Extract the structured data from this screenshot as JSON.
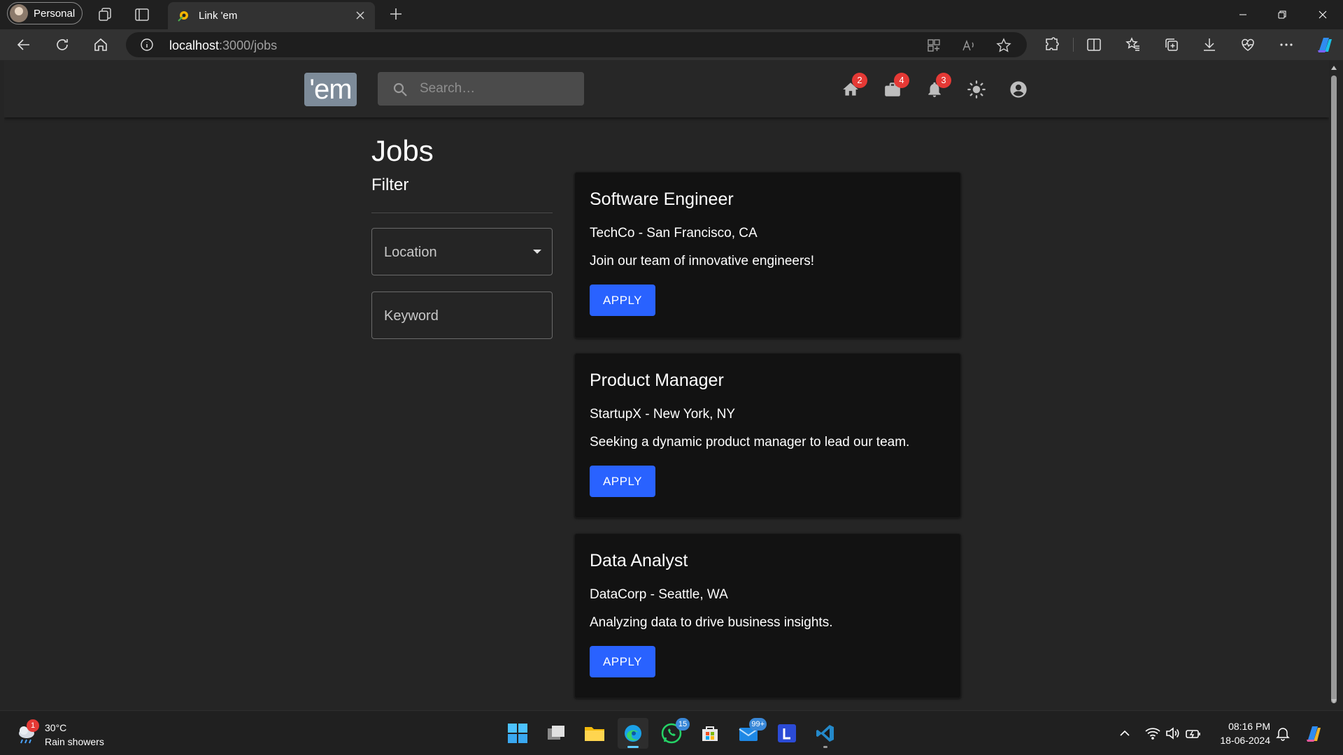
{
  "browser": {
    "profile_label": "Personal",
    "tab_title": "Link 'em",
    "url_host": "localhost",
    "url_path": ":3000/jobs"
  },
  "app": {
    "logo_text": "'em",
    "search_placeholder": "Search…",
    "icons": [
      "home-icon",
      "briefcase-icon",
      "bell-icon",
      "brightness-icon",
      "account-circle-icon"
    ],
    "badges": {
      "home": "2",
      "jobs": "4",
      "notifications": "3"
    }
  },
  "page": {
    "title": "Jobs",
    "filter_heading": "Filter",
    "location_label": "Location",
    "keyword_label": "Keyword"
  },
  "jobs": [
    {
      "title": "Software Engineer",
      "company": "TechCo - San Francisco, CA",
      "description": "Join our team of innovative engineers!",
      "apply_label": "APPLY"
    },
    {
      "title": "Product Manager",
      "company": "StartupX - New York, NY",
      "description": "Seeking a dynamic product manager to lead our team.",
      "apply_label": "APPLY"
    },
    {
      "title": "Data Analyst",
      "company": "DataCorp - Seattle, WA",
      "description": "Analyzing data to drive business insights.",
      "apply_label": "APPLY"
    }
  ],
  "taskbar": {
    "weather_temp": "30°C",
    "weather_condition": "Rain showers",
    "weather_badge": "1",
    "whatsapp_badge": "15",
    "mail_badge": "99+",
    "time": "08:16 PM",
    "date": "18-06-2024"
  },
  "colors": {
    "accent": "#2962ff",
    "badge": "#e53935",
    "logo_bg": "#7d8b99",
    "card_bg": "#121212",
    "page_bg": "#252525"
  }
}
